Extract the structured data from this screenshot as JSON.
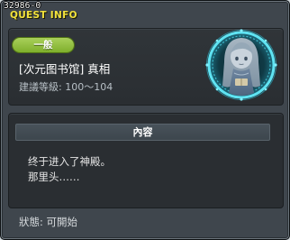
{
  "window": {
    "quest_id": "32986-0",
    "title": "QUEST INFO"
  },
  "header": {
    "category": "一般",
    "quest_name": "[次元图书馆] 真相",
    "level_range": "建議等級: 100～104",
    "portrait_icon": "npc-portrait-icon"
  },
  "contents": {
    "heading": "內容",
    "lines": [
      "终于进入了神殿。",
      "那里头……"
    ]
  },
  "status": {
    "text": "狀態: 可開始"
  },
  "colors": {
    "title_yellow": "#f2e23c",
    "badge_green": "#8fbf3c",
    "ring_cyan": "#5fe3f2"
  }
}
